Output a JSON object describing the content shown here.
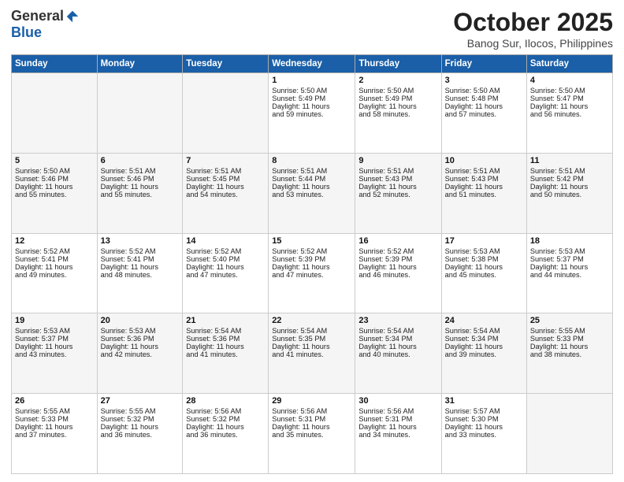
{
  "logo": {
    "general": "General",
    "blue": "Blue"
  },
  "header": {
    "month": "October 2025",
    "location": "Banog Sur, Ilocos, Philippines"
  },
  "weekdays": [
    "Sunday",
    "Monday",
    "Tuesday",
    "Wednesday",
    "Thursday",
    "Friday",
    "Saturday"
  ],
  "weeks": [
    [
      {
        "day": "",
        "info": ""
      },
      {
        "day": "",
        "info": ""
      },
      {
        "day": "",
        "info": ""
      },
      {
        "day": "1",
        "info": "Sunrise: 5:50 AM\nSunset: 5:49 PM\nDaylight: 11 hours\nand 59 minutes."
      },
      {
        "day": "2",
        "info": "Sunrise: 5:50 AM\nSunset: 5:49 PM\nDaylight: 11 hours\nand 58 minutes."
      },
      {
        "day": "3",
        "info": "Sunrise: 5:50 AM\nSunset: 5:48 PM\nDaylight: 11 hours\nand 57 minutes."
      },
      {
        "day": "4",
        "info": "Sunrise: 5:50 AM\nSunset: 5:47 PM\nDaylight: 11 hours\nand 56 minutes."
      }
    ],
    [
      {
        "day": "5",
        "info": "Sunrise: 5:50 AM\nSunset: 5:46 PM\nDaylight: 11 hours\nand 55 minutes."
      },
      {
        "day": "6",
        "info": "Sunrise: 5:51 AM\nSunset: 5:46 PM\nDaylight: 11 hours\nand 55 minutes."
      },
      {
        "day": "7",
        "info": "Sunrise: 5:51 AM\nSunset: 5:45 PM\nDaylight: 11 hours\nand 54 minutes."
      },
      {
        "day": "8",
        "info": "Sunrise: 5:51 AM\nSunset: 5:44 PM\nDaylight: 11 hours\nand 53 minutes."
      },
      {
        "day": "9",
        "info": "Sunrise: 5:51 AM\nSunset: 5:43 PM\nDaylight: 11 hours\nand 52 minutes."
      },
      {
        "day": "10",
        "info": "Sunrise: 5:51 AM\nSunset: 5:43 PM\nDaylight: 11 hours\nand 51 minutes."
      },
      {
        "day": "11",
        "info": "Sunrise: 5:51 AM\nSunset: 5:42 PM\nDaylight: 11 hours\nand 50 minutes."
      }
    ],
    [
      {
        "day": "12",
        "info": "Sunrise: 5:52 AM\nSunset: 5:41 PM\nDaylight: 11 hours\nand 49 minutes."
      },
      {
        "day": "13",
        "info": "Sunrise: 5:52 AM\nSunset: 5:41 PM\nDaylight: 11 hours\nand 48 minutes."
      },
      {
        "day": "14",
        "info": "Sunrise: 5:52 AM\nSunset: 5:40 PM\nDaylight: 11 hours\nand 47 minutes."
      },
      {
        "day": "15",
        "info": "Sunrise: 5:52 AM\nSunset: 5:39 PM\nDaylight: 11 hours\nand 47 minutes."
      },
      {
        "day": "16",
        "info": "Sunrise: 5:52 AM\nSunset: 5:39 PM\nDaylight: 11 hours\nand 46 minutes."
      },
      {
        "day": "17",
        "info": "Sunrise: 5:53 AM\nSunset: 5:38 PM\nDaylight: 11 hours\nand 45 minutes."
      },
      {
        "day": "18",
        "info": "Sunrise: 5:53 AM\nSunset: 5:37 PM\nDaylight: 11 hours\nand 44 minutes."
      }
    ],
    [
      {
        "day": "19",
        "info": "Sunrise: 5:53 AM\nSunset: 5:37 PM\nDaylight: 11 hours\nand 43 minutes."
      },
      {
        "day": "20",
        "info": "Sunrise: 5:53 AM\nSunset: 5:36 PM\nDaylight: 11 hours\nand 42 minutes."
      },
      {
        "day": "21",
        "info": "Sunrise: 5:54 AM\nSunset: 5:36 PM\nDaylight: 11 hours\nand 41 minutes."
      },
      {
        "day": "22",
        "info": "Sunrise: 5:54 AM\nSunset: 5:35 PM\nDaylight: 11 hours\nand 41 minutes."
      },
      {
        "day": "23",
        "info": "Sunrise: 5:54 AM\nSunset: 5:34 PM\nDaylight: 11 hours\nand 40 minutes."
      },
      {
        "day": "24",
        "info": "Sunrise: 5:54 AM\nSunset: 5:34 PM\nDaylight: 11 hours\nand 39 minutes."
      },
      {
        "day": "25",
        "info": "Sunrise: 5:55 AM\nSunset: 5:33 PM\nDaylight: 11 hours\nand 38 minutes."
      }
    ],
    [
      {
        "day": "26",
        "info": "Sunrise: 5:55 AM\nSunset: 5:33 PM\nDaylight: 11 hours\nand 37 minutes."
      },
      {
        "day": "27",
        "info": "Sunrise: 5:55 AM\nSunset: 5:32 PM\nDaylight: 11 hours\nand 36 minutes."
      },
      {
        "day": "28",
        "info": "Sunrise: 5:56 AM\nSunset: 5:32 PM\nDaylight: 11 hours\nand 36 minutes."
      },
      {
        "day": "29",
        "info": "Sunrise: 5:56 AM\nSunset: 5:31 PM\nDaylight: 11 hours\nand 35 minutes."
      },
      {
        "day": "30",
        "info": "Sunrise: 5:56 AM\nSunset: 5:31 PM\nDaylight: 11 hours\nand 34 minutes."
      },
      {
        "day": "31",
        "info": "Sunrise: 5:57 AM\nSunset: 5:30 PM\nDaylight: 11 hours\nand 33 minutes."
      },
      {
        "day": "",
        "info": ""
      }
    ]
  ]
}
